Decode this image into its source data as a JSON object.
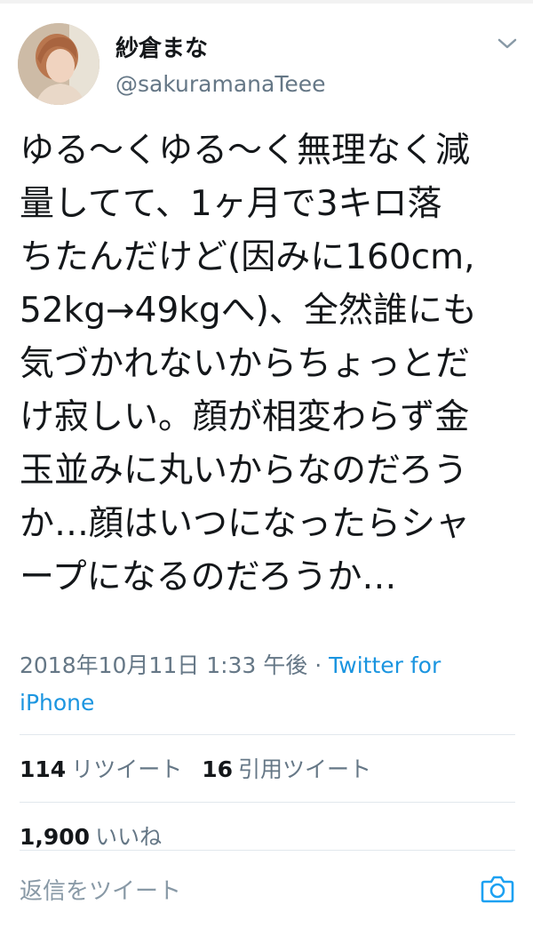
{
  "tweet": {
    "display_name": "紗倉まな",
    "handle": "@sakuramanaTeee",
    "text": "ゆる〜くゆる〜く無理なく減\n量してて、1ヶ月で3キロ落\nちたんだけど(因みに160cm,\n52kg→49kgへ)、全然誰にも\n気づかれないからちょっとだ\nけ寂しい。顔が相変わらず金\n玉並みに丸いからなのだろう\nか…顔はいつになったらシャ\nープになるのだろうか…",
    "timestamp": "2018年10月11日 1:33 午後",
    "separator": " · ",
    "source": "Twitter for iPhone"
  },
  "stats": {
    "retweets_count": "114",
    "retweets_label": "リツイート",
    "quotes_count": "16",
    "quotes_label": "引用ツイート",
    "likes_count": "1,900",
    "likes_label": "いいね"
  },
  "reply_bar": {
    "placeholder": "返信をツイート"
  },
  "icons": {
    "menu": "chevron-down-icon",
    "camera": "camera-icon"
  },
  "colors": {
    "text": "#14171a",
    "secondary": "#657786",
    "link": "#1b95e0",
    "divider": "#e1e8ed"
  }
}
